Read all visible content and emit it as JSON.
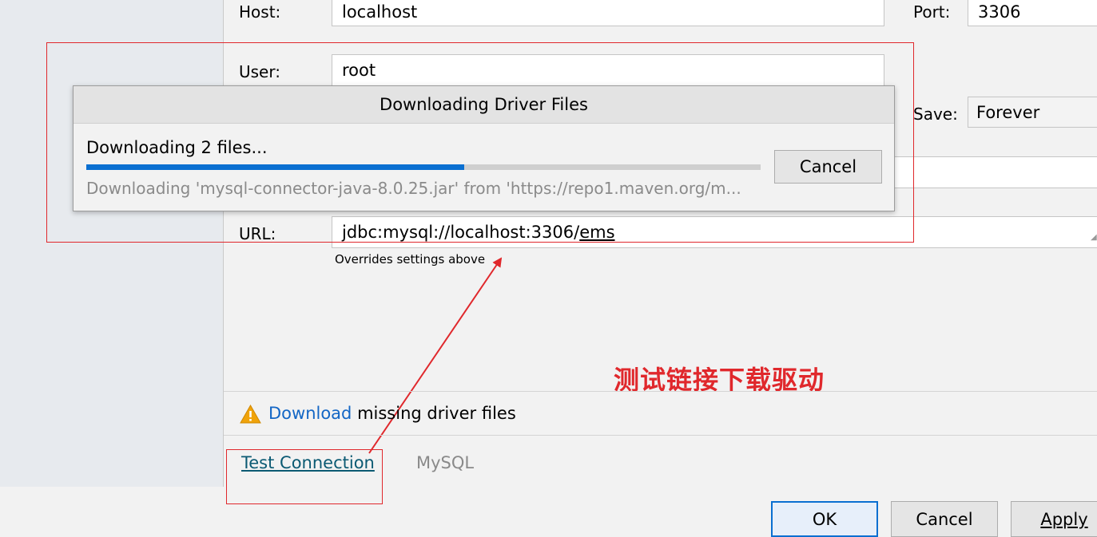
{
  "form": {
    "host_label": "Host:",
    "host_value": "localhost",
    "port_label": "Port:",
    "port_value": "3306",
    "user_label": "User:",
    "user_value": "root",
    "save_label": "Save:",
    "save_value": "Forever",
    "url_label": "URL:",
    "url_prefix": "jdbc:mysql://localhost:3306/",
    "url_db": "ems",
    "url_hint": "Overrides settings above"
  },
  "dialog": {
    "title": "Downloading Driver Files",
    "status": "Downloading 2 files...",
    "progress": 0.56,
    "detail": "Downloading 'mysql-connector-java-8.0.25.jar' from 'https://repo1.maven.org/m...",
    "cancel_label": "Cancel"
  },
  "annotation": {
    "text": "测试链接下载驱动",
    "color": "#e0282c"
  },
  "driver_notice": {
    "link": "Download",
    "rest": " missing driver files"
  },
  "footer": {
    "test_connection": "Test Connection",
    "driver_name": "MySQL",
    "ok": "OK",
    "cancel": "Cancel",
    "apply": "Apply"
  },
  "colors": {
    "accent": "#0a6fd1",
    "link": "#1366c5",
    "annotation": "#e0282c",
    "warning": "#f0a30a"
  }
}
